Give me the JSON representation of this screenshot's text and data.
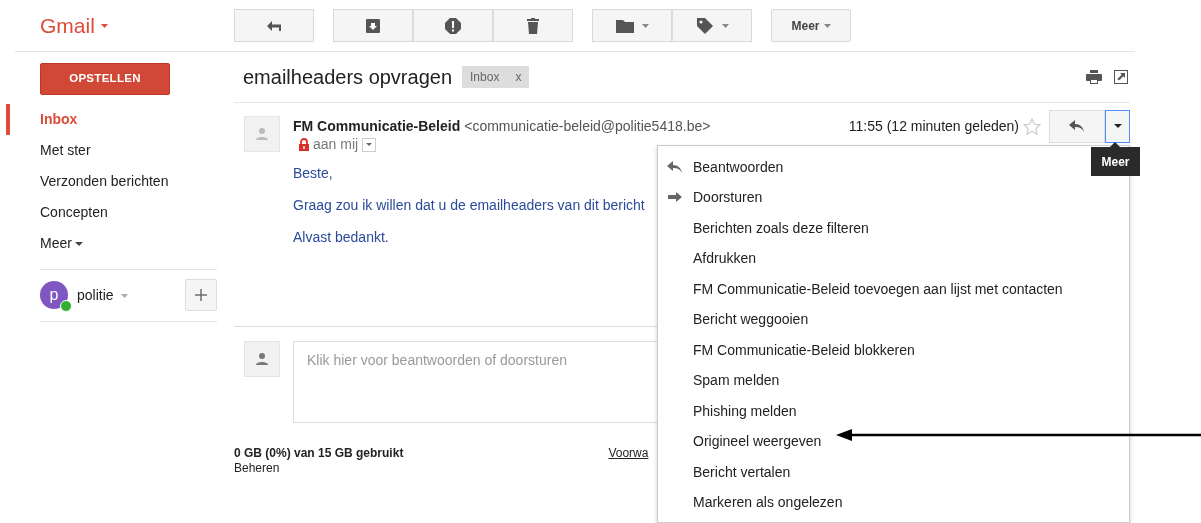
{
  "app": {
    "logo": "Gmail"
  },
  "toolbar": {
    "more_label": "Meer"
  },
  "compose": {
    "label": "OPSTELLEN"
  },
  "sidebar": {
    "items": [
      {
        "label": "Inbox",
        "selected": true,
        "kind": "folder"
      },
      {
        "label": "Met ster",
        "selected": false,
        "kind": "folder"
      },
      {
        "label": "Verzonden berichten",
        "selected": false,
        "kind": "folder"
      },
      {
        "label": "Concepten",
        "selected": false,
        "kind": "folder"
      },
      {
        "label": "Meer",
        "selected": false,
        "kind": "more"
      }
    ]
  },
  "account": {
    "initial": "p",
    "name": "politie",
    "online": true
  },
  "conversation": {
    "subject": "emailheaders opvragen",
    "labels": [
      {
        "text": "Inbox",
        "remove": "x"
      }
    ]
  },
  "message": {
    "sender": "FM Communicatie-Beleid",
    "address": "<communicatie-beleid@politie5418.be>",
    "time": "11:55 (12 minuten geleden)",
    "starred": false,
    "recipient": "aan mij",
    "body": [
      "Beste,",
      "Graag zou ik willen dat u de emailheaders van dit bericht",
      "Alvast bedankt."
    ]
  },
  "reply_box": {
    "prefix": "Klik hier voor",
    "reply_link": "beantwoorden",
    "middle": "of",
    "forward_link": "doorsturen"
  },
  "footer": {
    "usage": "0 GB (0%) van 15 GB gebruikt",
    "manage_link": "Beheren",
    "terms_link": "Voorwa"
  },
  "tooltip": {
    "text": "Meer"
  },
  "menu": {
    "items": [
      {
        "label": "Beantwoorden",
        "kind": "reply"
      },
      {
        "label": "Doorsturen",
        "kind": "forward"
      },
      {
        "label": "Berichten zoals deze filteren",
        "kind": "plain"
      },
      {
        "label": "Afdrukken",
        "kind": "plain"
      },
      {
        "label": "FM Communicatie-Beleid toevoegen aan lijst met contacten",
        "kind": "plain"
      },
      {
        "label": "Bericht weggooien",
        "kind": "plain"
      },
      {
        "label": "FM Communicatie-Beleid blokkeren",
        "kind": "plain"
      },
      {
        "label": "Spam melden",
        "kind": "plain"
      },
      {
        "label": "Phishing melden",
        "kind": "plain"
      },
      {
        "label": "Origineel weergeven",
        "kind": "plain"
      },
      {
        "label": "Bericht vertalen",
        "kind": "plain"
      },
      {
        "label": "Markeren als ongelezen",
        "kind": "plain"
      }
    ]
  }
}
